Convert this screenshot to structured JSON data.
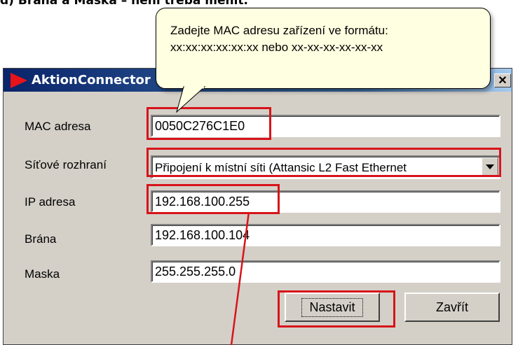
{
  "heading": "d)   Brána a Maska – není třeba měnit.",
  "window": {
    "title": "AktionConnector",
    "close_symbol": "✕"
  },
  "tooltip": {
    "line1": "Zadejte MAC adresu zařízení ve formátu:",
    "line2": "xx:xx:xx:xx:xx:xx nebo xx-xx-xx-xx-xx-xx"
  },
  "form": {
    "mac_label": "MAC adresa",
    "mac_value": "0050C276C1E0",
    "iface_label": "Síťové rozhraní",
    "iface_value": "Připojení k místní síti (Attansic L2 Fast Ethernet",
    "ip_label": "IP adresa",
    "ip_value": "192.168.100.255",
    "gateway_label": "Brána",
    "gateway_value": "192.168.100.104",
    "mask_label": "Maska",
    "mask_value": "255.255.255.0"
  },
  "buttons": {
    "set_label": "Nastavit",
    "close_label": "Zavřít"
  },
  "colors": {
    "highlight": "#d7141a",
    "tooltip_bg": "#ffffe1",
    "dialog_bg": "#d4d0c8"
  }
}
